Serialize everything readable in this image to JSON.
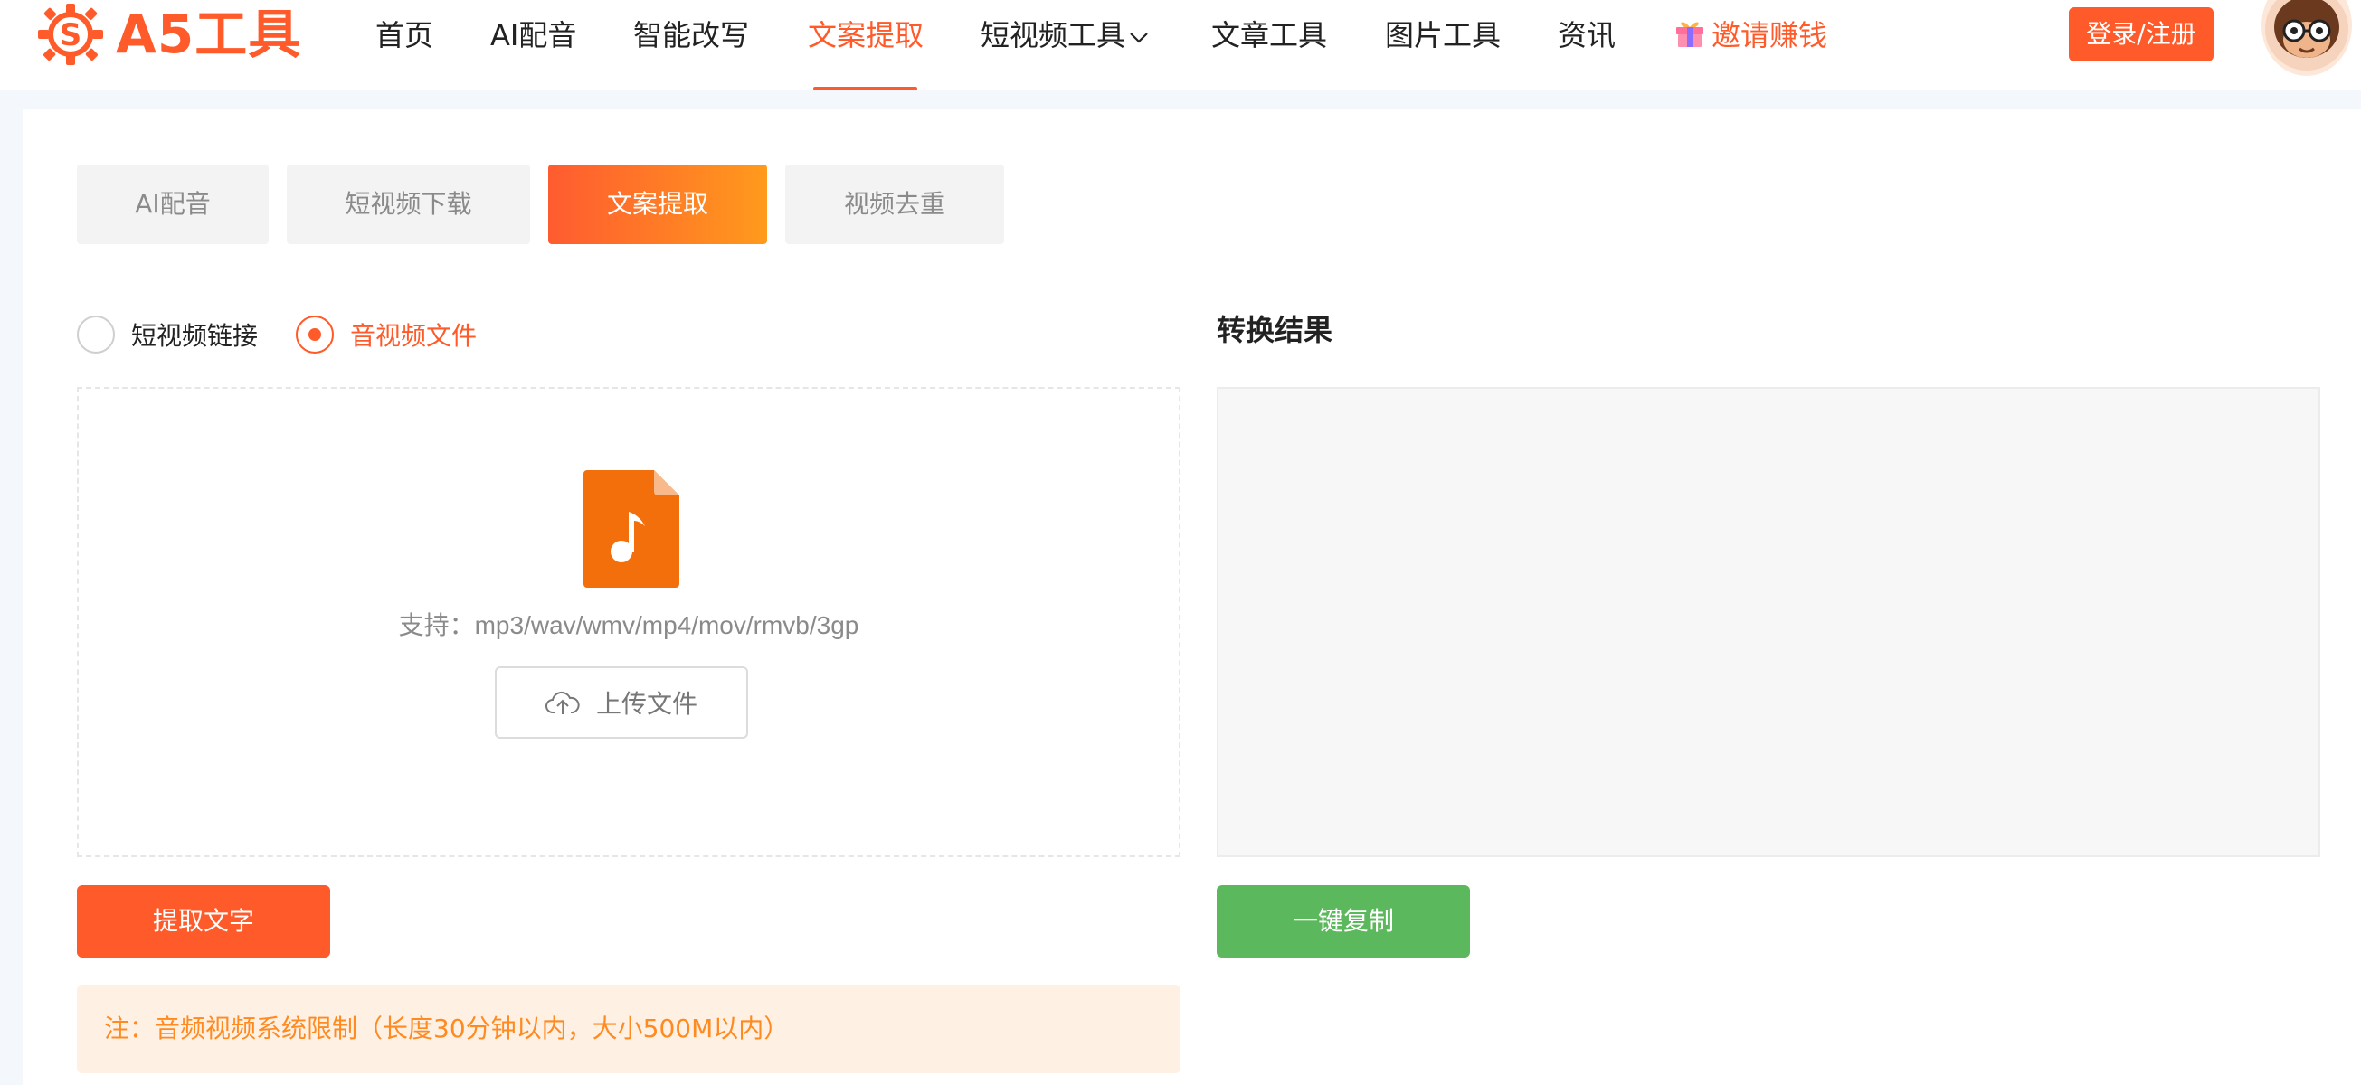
{
  "brand": {
    "logo_text": "A5工具",
    "accent": "#ff5a2a"
  },
  "nav": {
    "items": [
      "首页",
      "AI配音",
      "智能改写",
      "文案提取",
      "短视频工具",
      "文章工具",
      "图片工具",
      "资讯",
      "邀请赚钱"
    ],
    "active": "文案提取",
    "login_label": "登录/注册"
  },
  "tabs": {
    "items": [
      "AI配音",
      "短视频下载",
      "文案提取",
      "视频去重"
    ],
    "active": "文案提取"
  },
  "source": {
    "options": [
      "短视频链接",
      "音视频文件"
    ],
    "selected": "音视频文件"
  },
  "upload": {
    "support_text": "支持：mp3/wav/wmv/mp4/mov/rmvb/3gp",
    "button_label": "上传文件"
  },
  "result": {
    "title": "转换结果",
    "content": ""
  },
  "actions": {
    "extract_label": "提取文字",
    "copy_label": "一键复制"
  },
  "notice": "注：音频视频系统限制（长度30分钟以内，大小500M以内）",
  "colors": {
    "accent": "#ff5a2a",
    "tab_gradient_end": "#ff9a1c",
    "copy_button": "#5cb85c",
    "notice_bg": "#fff0e4",
    "notice_text": "#ff8a20"
  }
}
